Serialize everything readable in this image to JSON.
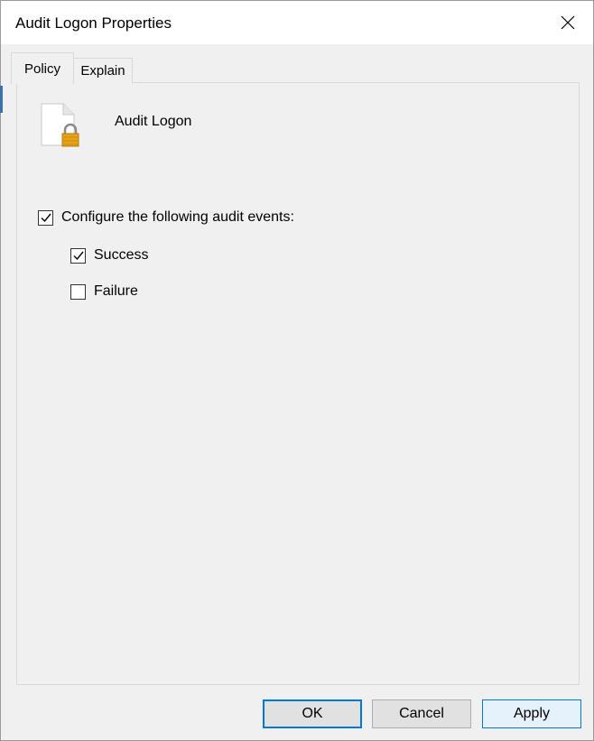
{
  "window": {
    "title": "Audit Logon Properties"
  },
  "tabs": [
    {
      "label": "Policy",
      "active": true
    },
    {
      "label": "Explain",
      "active": false
    }
  ],
  "policy": {
    "name": "Audit Logon",
    "icon": "document-lock-icon"
  },
  "options": {
    "configure": {
      "label": "Configure the following audit events:",
      "checked": true
    },
    "success": {
      "label": "Success",
      "checked": true
    },
    "failure": {
      "label": "Failure",
      "checked": false
    }
  },
  "buttons": {
    "ok": "OK",
    "cancel": "Cancel",
    "apply": "Apply"
  },
  "colors": {
    "accent": "#0078d7",
    "lock": "#e8a317"
  }
}
